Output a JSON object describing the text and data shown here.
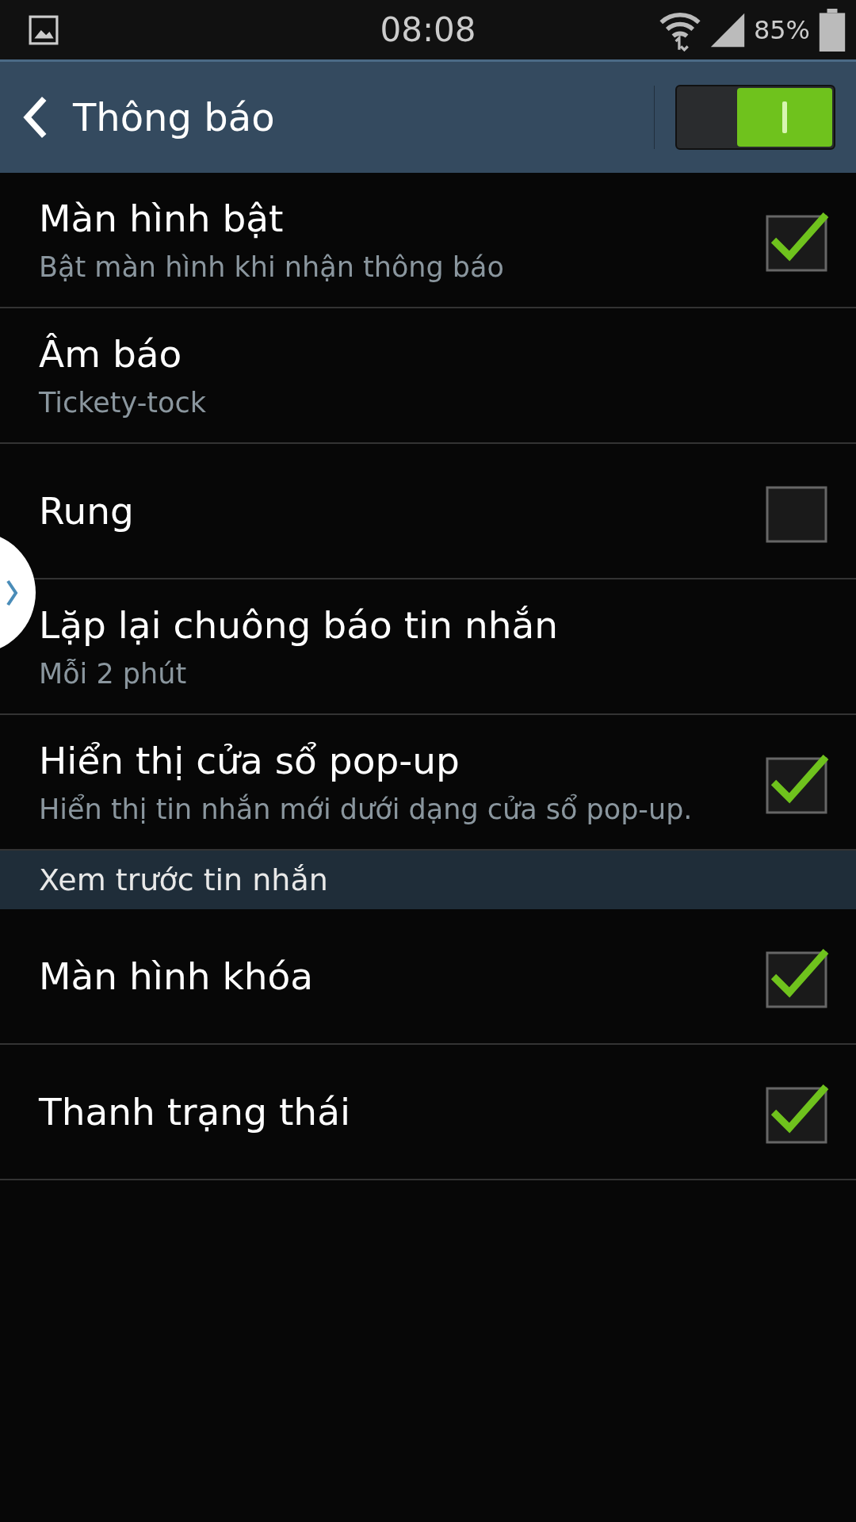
{
  "status_bar": {
    "time": "08:08",
    "battery": "85%"
  },
  "header": {
    "title": "Thông báo",
    "switch_on": true
  },
  "items": [
    {
      "kind": "check",
      "title": "Màn hình bật",
      "subtitle": "Bật màn hình khi nhận thông báo",
      "checked": true
    },
    {
      "kind": "plain",
      "title": "Âm báo",
      "subtitle": "Tickety-tock"
    },
    {
      "kind": "check",
      "title": "Rung",
      "checked": false
    },
    {
      "kind": "plain",
      "title": "Lặp lại chuông báo tin nhắn",
      "subtitle": "Mỗi 2 phút"
    },
    {
      "kind": "check",
      "title": "Hiển thị cửa sổ pop-up",
      "subtitle": "Hiển thị tin nhắn mới dưới dạng cửa sổ pop-up.",
      "checked": true
    },
    {
      "kind": "section",
      "title": "Xem trước tin nhắn"
    },
    {
      "kind": "check",
      "title": "Màn hình khóa",
      "checked": true
    },
    {
      "kind": "check",
      "title": "Thanh trạng thái",
      "checked": true
    }
  ]
}
